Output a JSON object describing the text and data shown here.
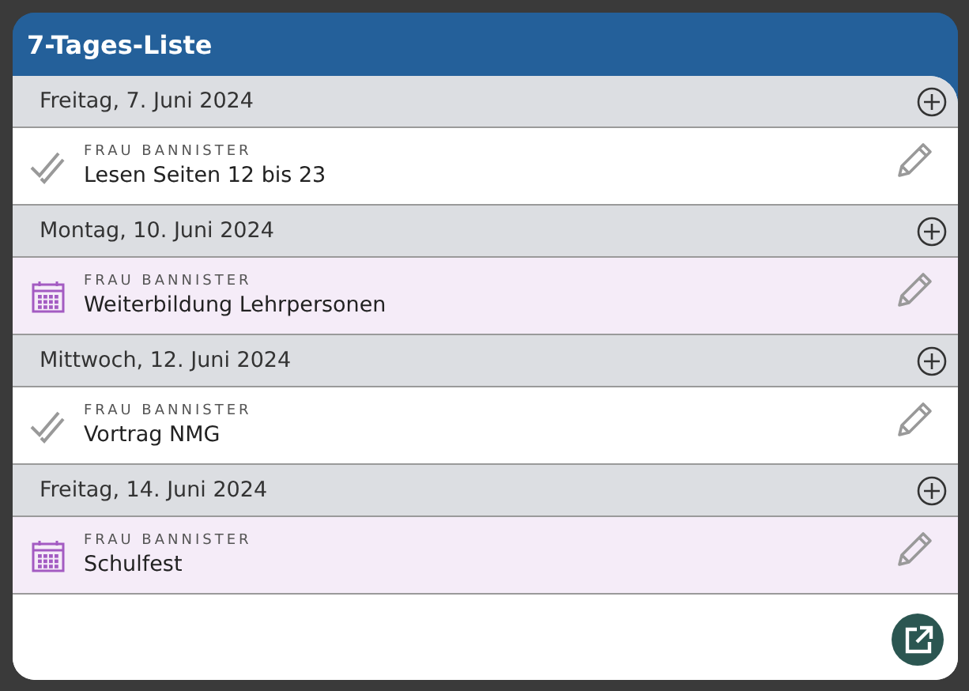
{
  "title": "7-Tages-Liste",
  "days": [
    {
      "date": "Freitag, 7. Juni 2024",
      "items": [
        {
          "kind": "task",
          "person": "FRAU BANNISTER",
          "title": "Lesen Seiten 12 bis 23"
        }
      ]
    },
    {
      "date": "Montag, 10. Juni 2024",
      "items": [
        {
          "kind": "event",
          "person": "FRAU BANNISTER",
          "title": "Weiterbildung Lehrpersonen"
        }
      ]
    },
    {
      "date": "Mittwoch, 12. Juni 2024",
      "items": [
        {
          "kind": "task",
          "person": "FRAU BANNISTER",
          "title": "Vortrag NMG"
        }
      ]
    },
    {
      "date": "Freitag, 14. Juni 2024",
      "items": [
        {
          "kind": "event",
          "person": "FRAU BANNISTER",
          "title": "Schulfest"
        }
      ]
    }
  ]
}
